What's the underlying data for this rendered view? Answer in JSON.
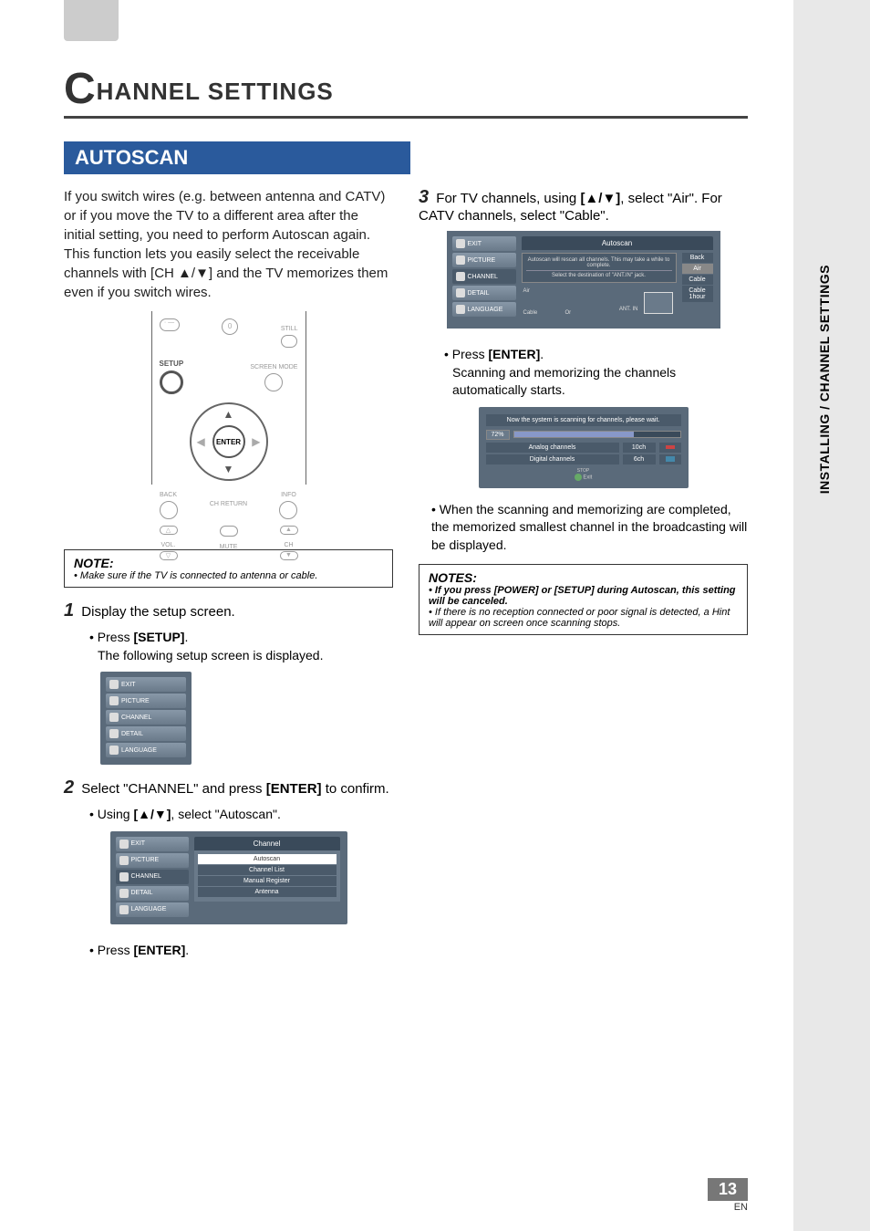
{
  "chapter": {
    "prefix_letter": "C",
    "title_rest": "HANNEL SETTINGS"
  },
  "section": {
    "title": "AUTOSCAN"
  },
  "intro": "If you switch wires (e.g. between antenna and CATV) or if you move the TV to a different area after the initial setting, you need to perform Autoscan again. This function lets you easily select the receivable channels with [CH ▲/▼] and the TV memorizes them even if you switch wires.",
  "remote": {
    "setup": "SETUP",
    "enter": "ENTER",
    "back": "BACK",
    "info": "INFO",
    "still": "STILL",
    "screen_mode": "SCREEN MODE",
    "ch_return": "CH RETURN",
    "vol": "VOL.",
    "mute": "MUTE",
    "ch": "CH",
    "zero": "0",
    "dot_dash": "· —"
  },
  "note1": {
    "title": "NOTE:",
    "line": "• Make sure if the TV is connected to antenna or cable."
  },
  "step1": {
    "text": "Display the setup screen.",
    "bullet1_a": "• Press ",
    "bullet1_b": "[SETUP]",
    "bullet1_c": ".",
    "bullet1_sub": "The following setup screen is displayed."
  },
  "menu1": {
    "items": [
      "EXIT",
      "PICTURE",
      "CHANNEL",
      "DETAIL",
      "LANGUAGE"
    ]
  },
  "step2": {
    "text_a": "Select \"CHANNEL\" and press ",
    "text_b": "[ENTER]",
    "text_c": " to confirm.",
    "bullet_a": "• Using ",
    "bullet_b": "[▲/▼]",
    "bullet_c": ", select \"Autoscan\".",
    "press_a": "• Press ",
    "press_b": "[ENTER]",
    "press_c": "."
  },
  "channel_menu": {
    "header": "Channel",
    "items": [
      "Autoscan",
      "Channel List",
      "Manual Register",
      "Antenna"
    ]
  },
  "step3": {
    "text_a": "For TV channels, using ",
    "text_b": "[▲/▼]",
    "text_c": ", select \"Air\". For CATV channels, select \"Cable\"."
  },
  "autoscan_menu": {
    "header": "Autoscan",
    "msg1": "Autoscan will rescan all channels. This may take a while to complete.",
    "msg2": "Select the destination of \"ANT.IN\" jack.",
    "opts": [
      "Back",
      "Air",
      "Cable",
      "Cable 1hour"
    ],
    "diag_air": "Air",
    "diag_cable": "Cable",
    "diag_or": "Or",
    "diag_ant": "ANT. IN"
  },
  "step3b": {
    "press_a": "• Press ",
    "press_b": "[ENTER]",
    "press_c": ".",
    "sub": "Scanning and memorizing the channels automatically starts."
  },
  "scan": {
    "msg": "Now the system is scanning for channels, please wait.",
    "pct": "72%",
    "analog_label": "Analog channels",
    "analog_count": "10ch",
    "digital_label": "Digital channels",
    "digital_count": "6ch",
    "exit_label": "Exit",
    "stop_label": "STOP"
  },
  "closing_bullet": "• When the scanning and memorizing are completed, the memorized smallest channel in the broadcasting will be displayed.",
  "notes2": {
    "title": "NOTES:",
    "l1": "• If you press [POWER] or [SETUP] during Autoscan, this setting will be canceled.",
    "l2": "• If there is no reception connected or poor signal is detected, a Hint will appear on screen once scanning stops."
  },
  "sidebar": "INSTALLING / CHANNEL SETTINGS",
  "footer": {
    "page": "13",
    "lang": "EN"
  }
}
